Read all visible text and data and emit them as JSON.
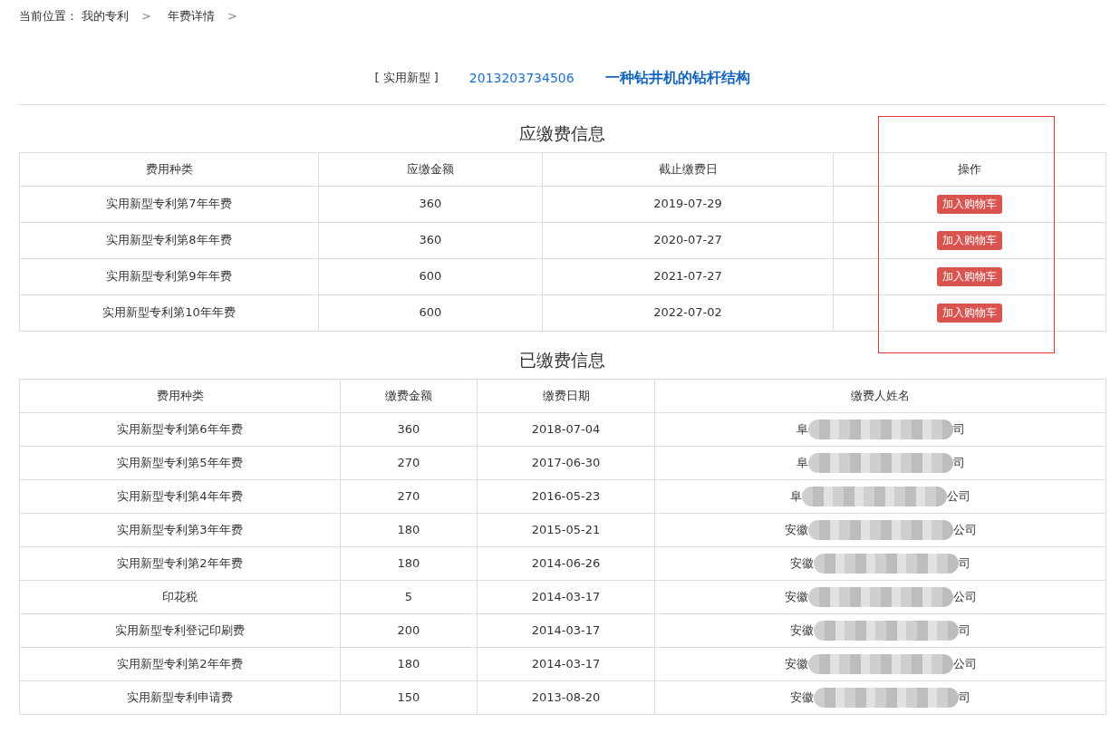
{
  "breadcrumb": {
    "label": "当前位置：",
    "items": [
      "我的专利",
      "年费详情"
    ],
    "separator": ">"
  },
  "patent": {
    "type": "[ 实用新型 ]",
    "number": "2013203734506",
    "title": "一种钻井机的钻杆结构"
  },
  "due_fees": {
    "title": "应缴费信息",
    "columns": [
      {
        "label": "费用种类",
        "highlighted": false
      },
      {
        "label": "应缴金额",
        "highlighted": false
      },
      {
        "label": "截止缴费日",
        "highlighted": false
      },
      {
        "label": "操作",
        "highlighted": true
      }
    ],
    "rows": [
      {
        "type": "实用新型专利第7年年费",
        "amount": "360",
        "deadline": "2019-07-29",
        "action": "加入购物车"
      },
      {
        "type": "实用新型专利第8年年费",
        "amount": "360",
        "deadline": "2020-07-27",
        "action": "加入购物车"
      },
      {
        "type": "实用新型专利第9年年费",
        "amount": "600",
        "deadline": "2021-07-27",
        "action": "加入购物车"
      },
      {
        "type": "实用新型专利第10年年费",
        "amount": "600",
        "deadline": "2022-07-02",
        "action": "加入购物车"
      }
    ]
  },
  "paid_fees": {
    "title": "已缴费信息",
    "columns": [
      "费用种类",
      "缴费金额",
      "缴费日期",
      "缴费人姓名"
    ],
    "rows": [
      {
        "type": "实用新型专利第6年年费",
        "amount": "360",
        "date": "2018-07-04",
        "payer_start": "阜",
        "payer_end": "司"
      },
      {
        "type": "实用新型专利第5年年费",
        "amount": "270",
        "date": "2017-06-30",
        "payer_start": "阜",
        "payer_end": "司"
      },
      {
        "type": "实用新型专利第4年年费",
        "amount": "270",
        "date": "2016-05-23",
        "payer_start": "阜",
        "payer_end": "公司"
      },
      {
        "type": "实用新型专利第3年年费",
        "amount": "180",
        "date": "2015-05-21",
        "payer_start": "安徽",
        "payer_end": "公司"
      },
      {
        "type": "实用新型专利第2年年费",
        "amount": "180",
        "date": "2014-06-26",
        "payer_start": "安徽",
        "payer_end": "司"
      },
      {
        "type": "印花税",
        "amount": "5",
        "date": "2014-03-17",
        "payer_start": "安徽",
        "payer_end": "公司"
      },
      {
        "type": "实用新型专利登记印刷费",
        "amount": "200",
        "date": "2014-03-17",
        "payer_start": "安徽",
        "payer_end": "司"
      },
      {
        "type": "实用新型专利第2年年费",
        "amount": "180",
        "date": "2014-03-17",
        "payer_start": "安徽",
        "payer_end": "公司"
      },
      {
        "type": "实用新型专利申请费",
        "amount": "150",
        "date": "2013-08-20",
        "payer_start": "安徽",
        "payer_end": "司"
      }
    ]
  }
}
